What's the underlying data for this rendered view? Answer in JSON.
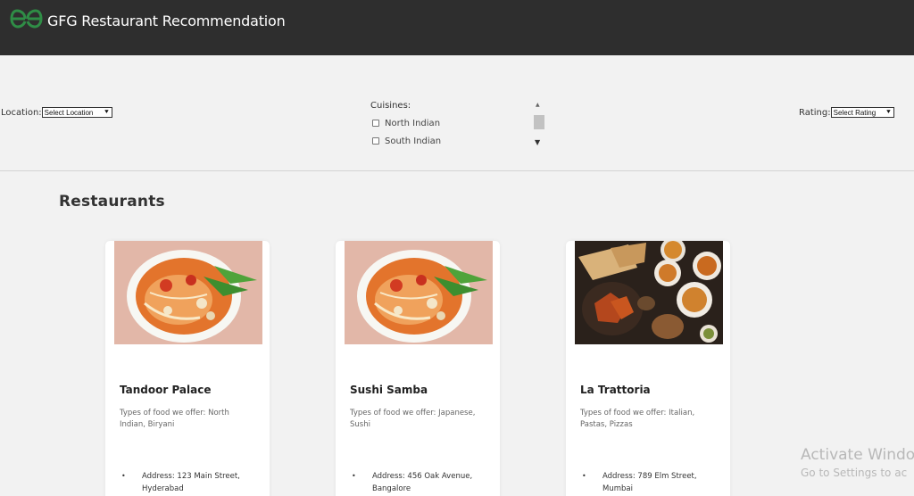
{
  "header": {
    "title": "GFG Restaurant Recommendation",
    "logo_icon": "gfg-logo-icon",
    "background": "#2e2e2e",
    "logo_color": "#2f8d46"
  },
  "filters": {
    "location_label": "Location:",
    "location_selected": "Select Location",
    "cuisines_label": "Cuisines:",
    "cuisines": [
      "North Indian",
      "South Indian"
    ],
    "rating_label": "Rating:",
    "rating_selected": "Select Rating"
  },
  "section_title": "Restaurants",
  "restaurants": [
    {
      "name": "Tandoor Palace",
      "food": "Types of food we offer: North Indian, Biryani",
      "address": "Address: 123 Main Street, Hyderabad",
      "image": "noodle-bowl-image"
    },
    {
      "name": "Sushi Samba",
      "food": "Types of food we offer: Japanese, Sushi",
      "address": "Address: 456 Oak Avenue, Bangalore",
      "image": "noodle-bowl-image"
    },
    {
      "name": "La Trattoria",
      "food": "Types of food we offer: Italian, Pastas, Pizzas",
      "address": "Address: 789 Elm Street, Mumbai",
      "image": "indian-spread-image"
    }
  ],
  "watermark": {
    "title": "Activate Windo",
    "subtitle": "Go to Settings to ac"
  }
}
